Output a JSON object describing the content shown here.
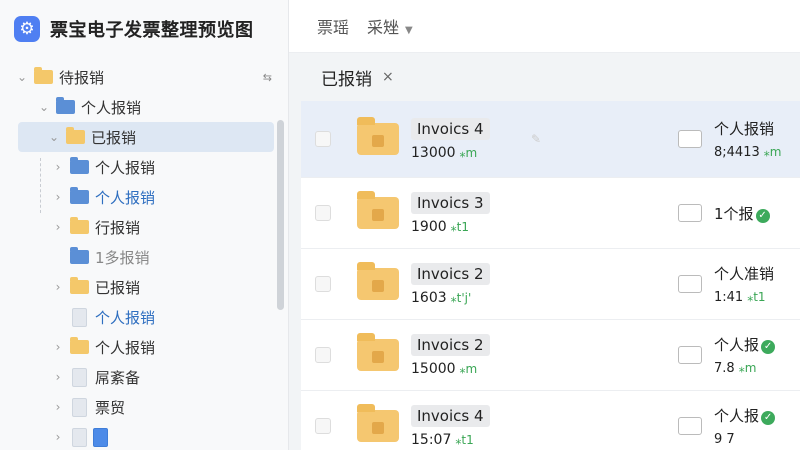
{
  "app": {
    "title": "票宝电子发票整理预览图",
    "logo_icon": "gear-icon"
  },
  "topbar": {
    "menu1": "票瑶",
    "menu2": "采矬"
  },
  "tab": {
    "label": "已报销",
    "close": "×"
  },
  "sidebar": {
    "root": {
      "label": "待报销",
      "sort_icon": "⇆"
    },
    "items": [
      {
        "label": "个人报销"
      },
      {
        "label": "已报销"
      },
      {
        "label": "个人报销"
      },
      {
        "label": "个人报销"
      },
      {
        "label": "行报销"
      },
      {
        "label": "1多报销"
      },
      {
        "label": "已报销"
      },
      {
        "label": "个人报销"
      },
      {
        "label": "个人报销"
      },
      {
        "label": "屌紊备"
      },
      {
        "label": "票贸"
      },
      {
        "label": ""
      }
    ]
  },
  "list": [
    {
      "name": "Invoics 4",
      "amount": "13000",
      "tag": "⁎m",
      "right_title": "个人报销",
      "right_sub": "8;4413",
      "right_tag": "⁎m",
      "badge": ""
    },
    {
      "name": "Invoics 3",
      "amount": "1900",
      "tag": "⁎t1",
      "right_title": "1个报",
      "right_sub": "",
      "right_tag": "",
      "badge": "✓"
    },
    {
      "name": "Invoics 2",
      "amount": "1603",
      "tag": "⁎t'j'",
      "right_title": "个人准销",
      "right_sub": "1:41",
      "right_tag": "⁎t1",
      "badge": ""
    },
    {
      "name": "Invoics 2",
      "amount": "15000",
      "tag": "⁎m",
      "right_title": "个人报",
      "right_sub": "7.8",
      "right_tag": "⁎m",
      "badge": "✓"
    },
    {
      "name": "Invoics 4",
      "amount": "15:07",
      "tag": "⁎t1",
      "right_title": "个人报",
      "right_sub": "9 7",
      "right_tag": "",
      "badge": "✓"
    }
  ]
}
